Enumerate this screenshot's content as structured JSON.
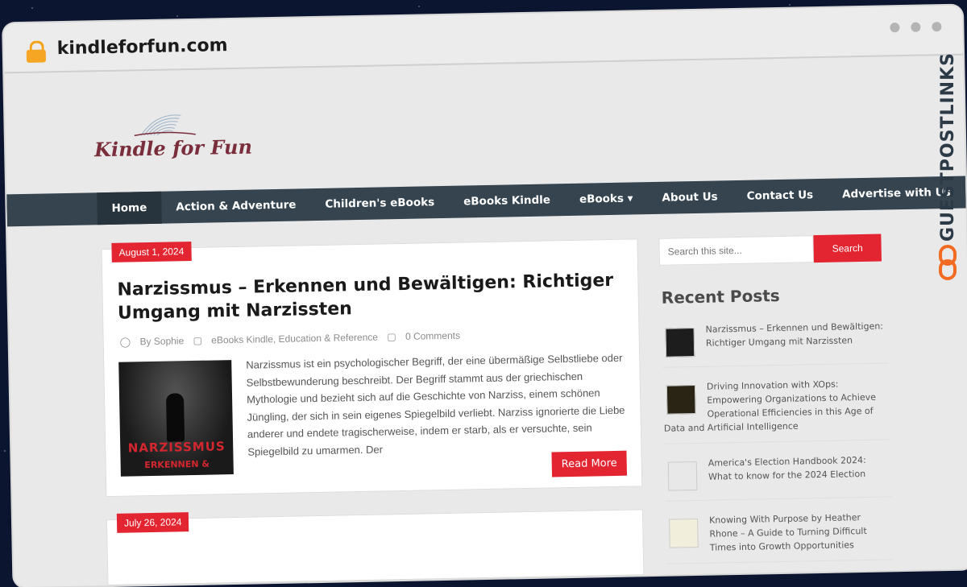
{
  "browser": {
    "url": "kindleforfun.com"
  },
  "site": {
    "logo_text": "Kindle for Fun"
  },
  "nav": {
    "items": [
      {
        "label": "Home",
        "active": true
      },
      {
        "label": "Action & Adventure"
      },
      {
        "label": "Children's eBooks"
      },
      {
        "label": "eBooks Kindle"
      },
      {
        "label": "eBooks ▾"
      },
      {
        "label": "About Us"
      },
      {
        "label": "Contact Us"
      },
      {
        "label": "Advertise with Us"
      }
    ]
  },
  "post": {
    "date": "August 1, 2024",
    "title": "Narzissmus – Erkennen und Bewältigen: Richtiger Umgang mit Narzissten",
    "author": "By Sophie",
    "categories": "eBooks Kindle, Education & Reference",
    "comments": "0 Comments",
    "thumb_title": "NARZISSMUS",
    "thumb_subtitle": "ERKENNEN &",
    "excerpt": "Narzissmus ist ein psychologischer Begriff, der eine übermäßige Selbstliebe oder Selbstbewunderung beschreibt. Der Begriff stammt aus der griechischen Mythologie und bezieht sich auf die Geschichte von Narziss, einem schönen Jüngling, der sich in sein eigenes Spiegelbild verliebt. Narziss ignorierte die Liebe anderer und endete tragischerweise, indem er starb, als er versuchte, sein Spiegelbild zu umarmen. Der",
    "read_more": "Read More"
  },
  "post2": {
    "date": "July 26, 2024"
  },
  "sidebar": {
    "search_placeholder": "Search this site...",
    "search_button": "Search",
    "recent_title": "Recent Posts",
    "recent": [
      {
        "title": "Narzissmus – Erkennen und Bewältigen: Richtiger Umgang mit Narzissten",
        "thumb_color": "#1d1d1d"
      },
      {
        "title": "Driving Innovation with XOps: Empowering Organizations to Achieve Operational Efficiencies in this Age of Data and Artificial Intelligence",
        "thumb_color": "#2a2415"
      },
      {
        "title": "America's Election Handbook 2024: What to know for the 2024 Election",
        "thumb_color": "#e8e8e8"
      },
      {
        "title": "Knowing With Purpose by Heather Rhone – A Guide to Turning Difficult Times into Growth Opportunities",
        "thumb_color": "#f1eedb"
      }
    ]
  },
  "badge": {
    "text": "GUESTPOSTLINKS"
  },
  "colors": {
    "accent": "#e32531",
    "nav": "#35444f",
    "badge_orange": "#f26b21"
  }
}
